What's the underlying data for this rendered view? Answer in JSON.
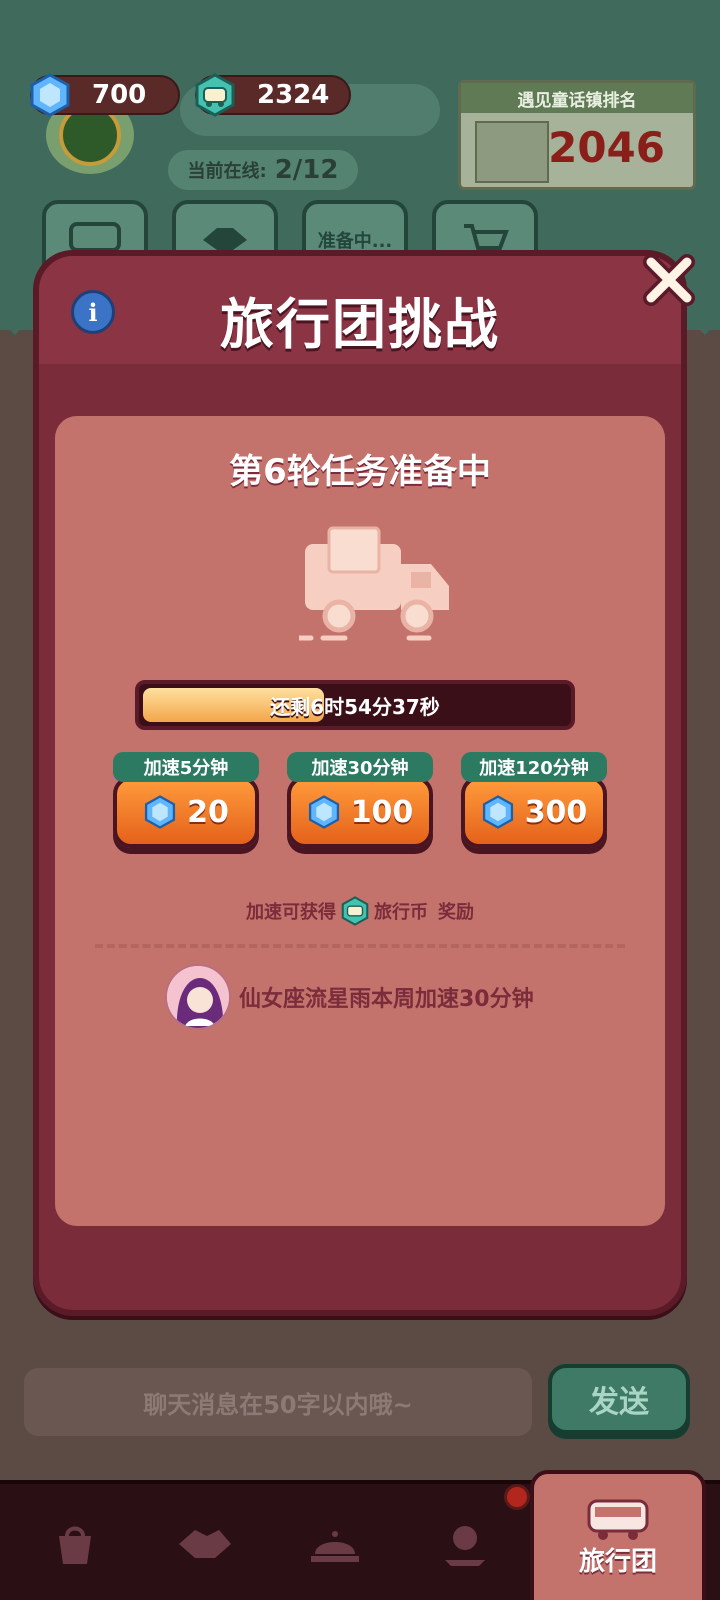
{
  "currencies": {
    "gems": "700",
    "travel_coins": "2324"
  },
  "team": {
    "online_label": "当前在线:",
    "online_count": "2/12"
  },
  "rank_card": {
    "title": "遇见童话镇排名",
    "rank": "2046"
  },
  "top_tabs": [
    {
      "label": ""
    },
    {
      "label": ""
    },
    {
      "label": "准备中..."
    },
    {
      "label": ""
    }
  ],
  "modal": {
    "title": "旅行团挑战",
    "info_icon": "i",
    "round_title": "第6轮任务准备中",
    "progress": {
      "label": "还剩6时54分37秒",
      "fraction": 0.42
    },
    "speedups": [
      {
        "tag": "加速5分钟",
        "cost": "20"
      },
      {
        "tag": "加速30分钟",
        "cost": "100"
      },
      {
        "tag": "加速120分钟",
        "cost": "300"
      }
    ],
    "reward_note": {
      "prefix": "加速可获得",
      "coin_name": "旅行币",
      "suffix": "奖励"
    },
    "activity": {
      "text": "仙女座流星雨本周加速30分钟"
    }
  },
  "chat": {
    "placeholder": "聊天消息在50字以内哦~",
    "send_label": "发送"
  },
  "bottom_nav": {
    "active_label": "旅行团"
  },
  "colors": {
    "modal": "#7a2c3a",
    "panel": "#c4736c",
    "speed_button": "#ff9a3b",
    "tag_green": "#2d7a63"
  }
}
